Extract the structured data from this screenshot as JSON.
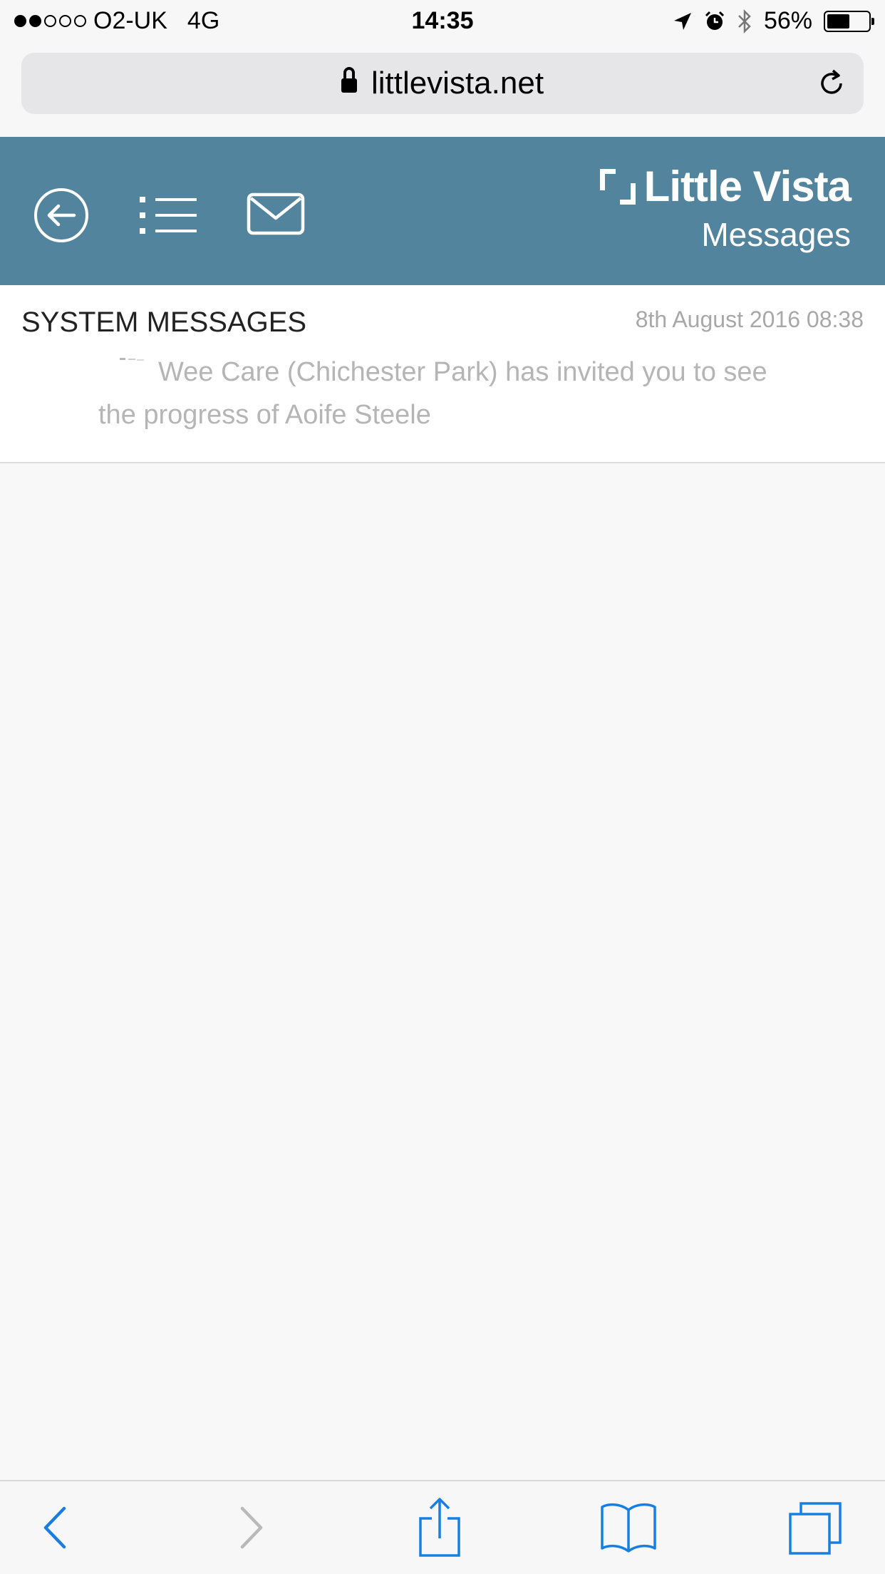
{
  "status_bar": {
    "carrier": "O2-UK",
    "network": "4G",
    "time": "14:35",
    "battery": "56%",
    "battery_level": 0.56,
    "signal_bars_filled": 2,
    "signal_bars_total": 5,
    "icons": [
      "location-arrow-icon",
      "alarm-icon",
      "bluetooth-icon",
      "battery-icon"
    ]
  },
  "browser": {
    "url": "littlevista.net",
    "lock_icon": "lock-icon",
    "reload_icon": "reload-icon"
  },
  "header": {
    "icons": [
      "back-circle-icon",
      "list-icon",
      "mail-icon"
    ],
    "brand": "Little Vista",
    "subtitle": "Messages",
    "color": "#52849e"
  },
  "messages": {
    "section_title": "SYSTEM MESSAGES",
    "items": [
      {
        "date": "8th August 2016 08:38",
        "text": "Wee Care (Chichester Park)  has invited you to see the progress of Aoife Steele"
      }
    ]
  },
  "toolbar": {
    "icons": [
      "back-icon",
      "forward-icon",
      "share-icon",
      "bookmarks-icon",
      "tabs-icon"
    ],
    "accent": "#1a7ee0"
  }
}
